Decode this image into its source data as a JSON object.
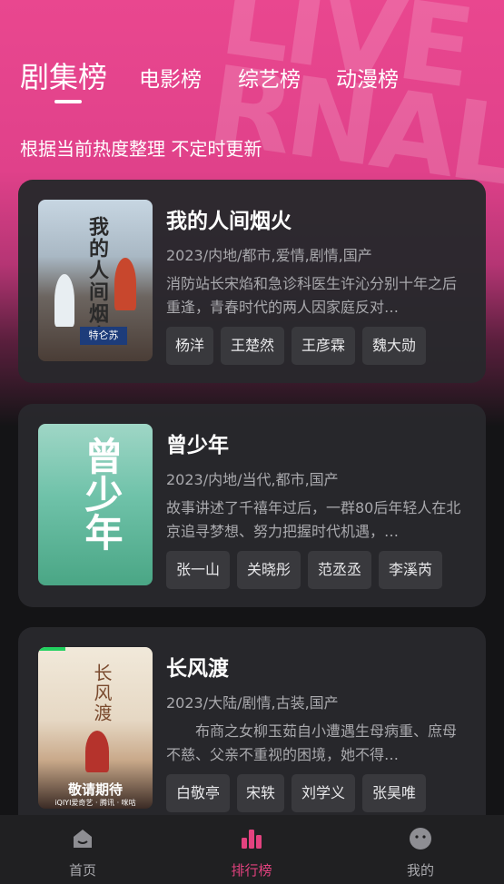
{
  "tabs": [
    {
      "label": "剧集榜",
      "active": true
    },
    {
      "label": "电影榜",
      "active": false
    },
    {
      "label": "综艺榜",
      "active": false
    },
    {
      "label": "动漫榜",
      "active": false
    }
  ],
  "subtitle": "根据当前热度整理 不定时更新",
  "hero_deco_text": "LIVE\nRNAL",
  "accent_color": "#e3427f",
  "items": [
    {
      "title": "我的人间烟火",
      "meta": "2023/内地/都市,爱情,剧情,国产",
      "description": "消防站长宋焰和急诊科医生许沁分别十年之后重逢，青春时代的两人因家庭反对…",
      "poster_text": "我的人间烟火",
      "poster_badge": "特仑苏",
      "cast": [
        "杨洋",
        "王楚然",
        "王彦霖",
        "魏大勋"
      ]
    },
    {
      "title": "曾少年",
      "meta": "2023/内地/当代,都市,国产",
      "description": "故事讲述了千禧年过后，一群80后年轻人在北京追寻梦想、努力把握时代机遇，…",
      "poster_text": "曾少年",
      "cast": [
        "张一山",
        "关晓彤",
        "范丞丞",
        "李溪芮"
      ]
    },
    {
      "title": "长风渡",
      "meta": "2023/大陆/剧情,古装,国产",
      "description": "　　布商之女柳玉茹自小遭遇生母病重、庶母不慈、父亲不重视的困境，她不得…",
      "poster_text": "长风渡",
      "poster_await": "敬请期待",
      "poster_logos": "iQIYI爱奇艺 · 腾讯 · 咪咕",
      "cast": [
        "白敬亭",
        "宋轶",
        "刘学义",
        "张昊唯"
      ]
    }
  ],
  "bottom_nav": [
    {
      "label": "首页",
      "icon": "home-icon",
      "active": false
    },
    {
      "label": "排行榜",
      "icon": "ranking-icon",
      "active": true
    },
    {
      "label": "我的",
      "icon": "profile-icon",
      "active": false
    }
  ]
}
